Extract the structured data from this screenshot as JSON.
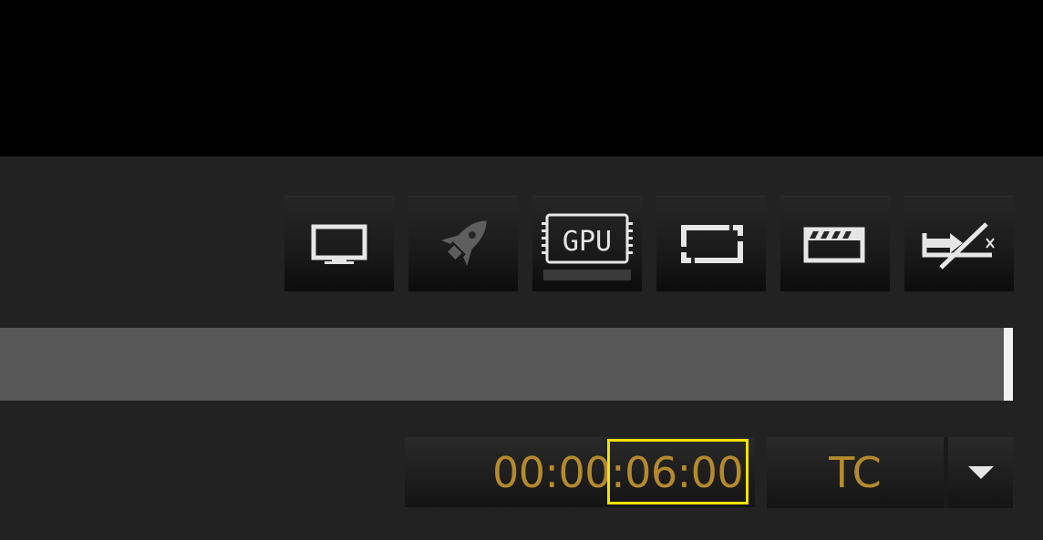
{
  "toolbar": {
    "buttons": [
      {
        "name": "monitor-output-button",
        "icon": "monitor-icon"
      },
      {
        "name": "quick-render-button",
        "icon": "rocket-icon"
      },
      {
        "name": "gpu-acceleration-button",
        "icon": "gpu-chip-icon",
        "label": "GPU"
      },
      {
        "name": "safe-area-button",
        "icon": "safe-area-frame-icon"
      },
      {
        "name": "clapperboard-button",
        "icon": "clapperboard-icon"
      },
      {
        "name": "disable-output-button",
        "icon": "output-disabled-icon"
      }
    ]
  },
  "progress": {
    "value": 1.0
  },
  "timecode": {
    "value": "00:00:06:00",
    "highlighted_part": "06:00",
    "color": "#b58a2e"
  },
  "display_mode": {
    "selected": "TC",
    "dropdown_icon": "triangle-down-icon"
  },
  "colors": {
    "highlight": "#f4e200",
    "panel": "#222222",
    "track": "#575757"
  }
}
